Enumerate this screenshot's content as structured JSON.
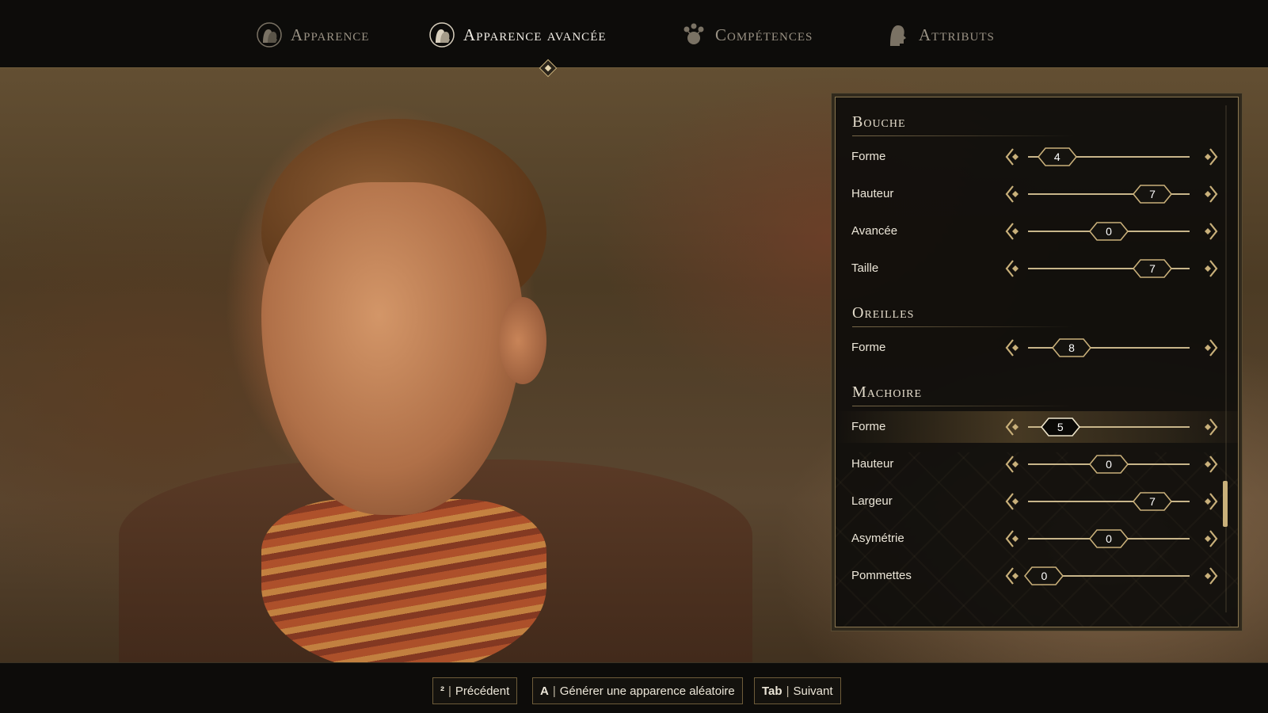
{
  "nav": {
    "tabs": [
      {
        "label": "Apparence",
        "icon": "heads-icon",
        "active": false
      },
      {
        "label": "Apparence avancée",
        "icon": "heads-icon",
        "active": true
      },
      {
        "label": "Compétences",
        "icon": "skills-icon",
        "active": false
      },
      {
        "label": "Attributs",
        "icon": "head-silhouette-icon",
        "active": false
      }
    ]
  },
  "panel": {
    "sections": [
      {
        "title": "Bouche",
        "rows": [
          {
            "label": "Forme",
            "value": "4"
          },
          {
            "label": "Hauteur",
            "value": "7"
          },
          {
            "label": "Avancée",
            "value": "0"
          },
          {
            "label": "Taille",
            "value": "7"
          }
        ]
      },
      {
        "title": "Oreilles",
        "rows": [
          {
            "label": "Forme",
            "value": "8"
          }
        ]
      },
      {
        "title": "Machoire",
        "rows": [
          {
            "label": "Forme",
            "value": "5",
            "selected": true
          },
          {
            "label": "Hauteur",
            "value": "0"
          },
          {
            "label": "Largeur",
            "value": "7"
          },
          {
            "label": "Asymétrie",
            "value": "0"
          },
          {
            "label": "Pommettes",
            "value": "0"
          }
        ]
      }
    ],
    "slider_fill_levels": [
      0.18,
      0.77,
      0.5,
      0.77,
      0.27,
      0.2,
      0.5,
      0.77,
      0.5,
      0.1
    ]
  },
  "hints": {
    "prev": {
      "key": "²",
      "label": "Précédent"
    },
    "random": {
      "key": "A",
      "label": "Générer une apparence aléatoire"
    },
    "next": {
      "key": "Tab",
      "label": "Suivant"
    }
  },
  "colors": {
    "accent_gold": "#c9b07a",
    "panel_bg": "#0e0d0b"
  }
}
